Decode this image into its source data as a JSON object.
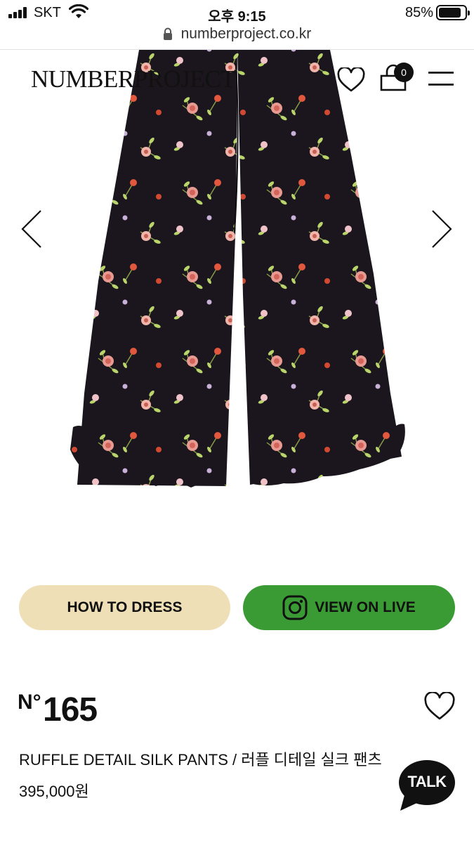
{
  "status_bar": {
    "carrier": "SKT",
    "time": "오후 9:15",
    "battery": "85%",
    "battery_level": 0.85
  },
  "browser": {
    "url": "numberproject.co.kr"
  },
  "header": {
    "logo": "NUMBERPROJECT",
    "cart_count": "0",
    "icons": [
      "heart-icon",
      "cart-icon",
      "menu-icon"
    ]
  },
  "gallery": {
    "image": "black floral print ruffle-hem wide silk pants",
    "prev_icon": "chevron-left-icon",
    "next_icon": "chevron-right-icon"
  },
  "actions": {
    "how_to_dress": "HOW TO DRESS",
    "view_on_live": "VIEW ON LIVE",
    "how_to_dress_color": "#efdfb6",
    "view_on_live_color": "#3a9b35"
  },
  "product": {
    "number_prefix": "N°",
    "number": "165",
    "name": "RUFFLE DETAIL SILK PANTS / 러플 디테일 실크 팬츠",
    "price": "395,000원"
  },
  "chat": {
    "label": "TALK"
  }
}
